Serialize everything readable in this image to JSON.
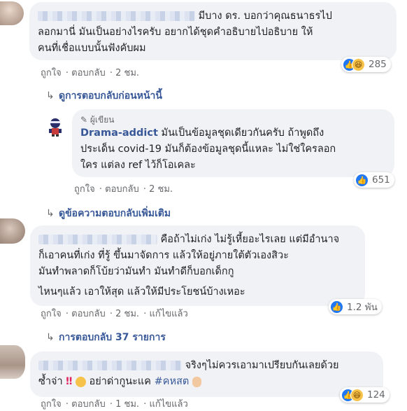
{
  "comments": [
    {
      "lines": [
        "มีบาง ดร. บอกว่าคุณธนาธรไป",
        "ลอกมานี่ มันเป็นอย่างไรครับ อยากได้ชุดคำอธิบายไปอธิบาย ให้",
        "คนที่เชื่อแบบนั้นฟังคับผม"
      ],
      "actions": {
        "like": "ถูกใจ",
        "reply": "ตอบกลับ",
        "time": "2 ชม."
      },
      "reaction_count": "285"
    },
    {
      "author_badge": "ผู้เขียน",
      "author": "Drama-addict",
      "lines": [
        "มันเป็นข้อมูลชุดเดียวกันครับ ถ้าพูดถึง",
        "ประเด็น covid-19 มันก็ต้องข้อมูลชุดนี้แหละ ไม่ใช่ใครลอก",
        "ใคร แต่ลง ref ไว้ก็โอเคละ"
      ],
      "actions": {
        "like": "ถูกใจ",
        "reply": "ตอบกลับ",
        "time": "2 ชม."
      },
      "reaction_count": "651"
    },
    {
      "lines": [
        "คือถ้าไม่เก่ง ไม่รู้เหี้ยอะไรเลย แต่มีอำนาจ",
        "ก็เอาคนที่เก่ง ที่รู้ ขึ้นมาจัดการ แล้วให้อยู่ภายใต้ตัวเองสิวะ",
        "มันทำพลาดก็โบ้ยว่ามันทำ มันทำดีก็บอกเด็กกู",
        "ไหนๆแล้ว เอาให้สุด แล้วให้มีประโยชน์บ้างเหอะ"
      ],
      "actions": {
        "like": "ถูกใจ",
        "reply": "ตอบกลับ",
        "time": "2 ชม.",
        "edited": "แก้ไขแล้ว"
      },
      "reaction_count": "1.2 พัน"
    },
    {
      "lines": [
        "จริงๆไม่ควรเอามาเปรียบกันเลยด้วย",
        "ซ้ำจ่า",
        "อย่าด่ากูนะแค",
        "#คหสต"
      ],
      "actions": {
        "like": "ถูกใจ",
        "reply": "ตอบกลับ",
        "time": "1 ชม.",
        "edited": "แก้ไขแล้ว"
      },
      "reaction_count": "124"
    }
  ],
  "reply_links": {
    "previous": "ดูการตอบกลับก่อนหน้านี้",
    "more": "ดูข้อความตอบกลับเพิ่มเติม",
    "count": "การตอบกลับ 37 รายการ"
  },
  "icons": {
    "reply_arrow": "↳",
    "like": "thumbs-up-icon",
    "haha": "haha-icon"
  },
  "colors": {
    "link": "#385898",
    "bubble": "#f0f2f5",
    "like": "#2078f4",
    "meta": "#65676b"
  }
}
